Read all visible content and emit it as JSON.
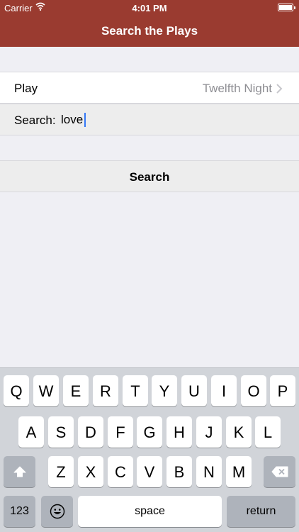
{
  "status_bar": {
    "carrier": "Carrier",
    "time": "4:01 PM"
  },
  "nav": {
    "title": "Search the Plays"
  },
  "form": {
    "play_label": "Play",
    "play_value": "Twelfth Night",
    "search_label": "Search:",
    "search_value": "love",
    "search_button": "Search"
  },
  "keyboard": {
    "row1": [
      "Q",
      "W",
      "E",
      "R",
      "T",
      "Y",
      "U",
      "I",
      "O",
      "P"
    ],
    "row2": [
      "A",
      "S",
      "D",
      "F",
      "G",
      "H",
      "J",
      "K",
      "L"
    ],
    "row3": [
      "Z",
      "X",
      "C",
      "V",
      "B",
      "N",
      "M"
    ],
    "numbers_key": "123",
    "space_key": "space",
    "return_key": "return"
  },
  "colors": {
    "accent": "#9a3b30",
    "caret": "#3478f6"
  }
}
